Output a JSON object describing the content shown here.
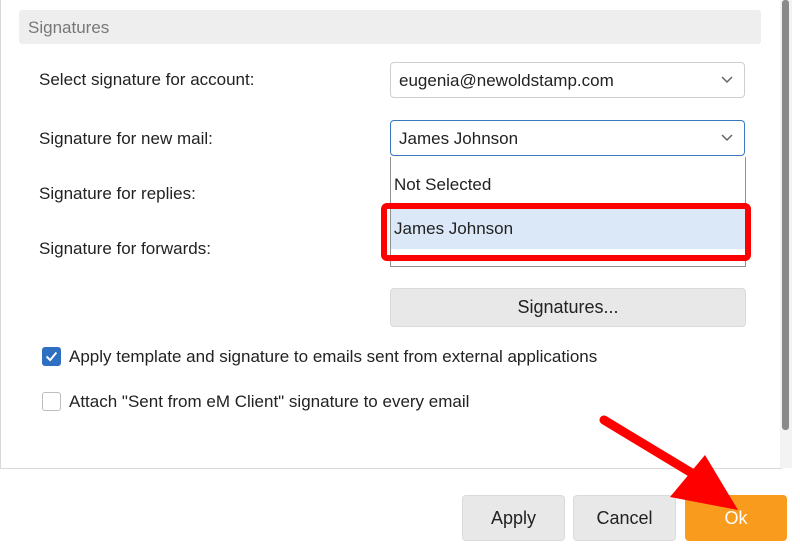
{
  "section": {
    "title": "Signatures"
  },
  "rows": {
    "account_label": "Select signature for account:",
    "account_value": "eugenia@newoldstamp.com",
    "new_mail_label": "Signature for new mail:",
    "new_mail_value": "James Johnson",
    "replies_label": "Signature for replies:",
    "forwards_label": "Signature for forwards:"
  },
  "dropdown": {
    "options": [
      "Not Selected",
      "James Johnson"
    ],
    "selected": "James Johnson"
  },
  "signatures_button": "Signatures...",
  "checkboxes": {
    "apply_template_label": "Apply template and signature to emails sent from external applications",
    "apply_template_checked": true,
    "attach_sent_from_label": "Attach \"Sent from eM Client\" signature to every email",
    "attach_sent_from_checked": false
  },
  "footer": {
    "apply": "Apply",
    "cancel": "Cancel",
    "ok": "Ok"
  },
  "colors": {
    "accent": "#2f6fc1",
    "ok_button": "#f99b1c",
    "annotation": "#ff0000",
    "selected_option": "#dbe8f7"
  }
}
